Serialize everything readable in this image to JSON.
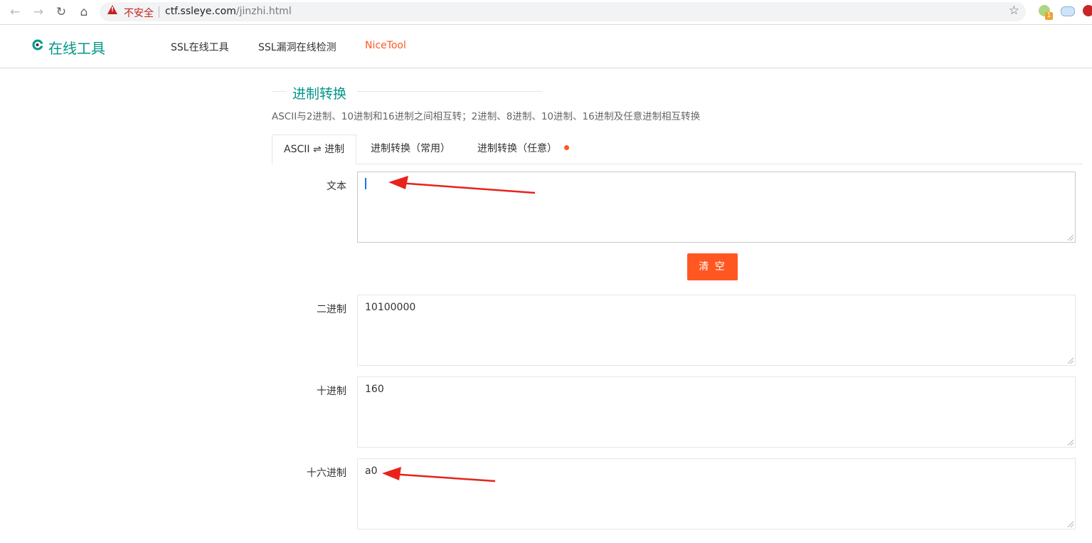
{
  "browser": {
    "security_label": "不安全",
    "url_host": "ctf.ssleye.com",
    "url_path": "/jinzhi.html",
    "extension_badge": "1"
  },
  "site": {
    "logo_text": "在线工具",
    "nav": [
      "SSL在线工具",
      "SSL漏洞在线检测",
      "NiceTool"
    ]
  },
  "main": {
    "title": "进制转换",
    "description": "ASCII与2进制、10进制和16进制之间相互转；2进制、8进制、10进制、16进制及任意进制相互转换",
    "tabs": [
      "ASCII ⇌ 进制",
      "进制转换（常用）",
      "进制转换（任意）"
    ],
    "fields": {
      "text_label": "文本",
      "text_value": "",
      "binary_label": "二进制",
      "binary_value": "10100000",
      "decimal_label": "十进制",
      "decimal_value": "160",
      "hex_label": "十六进制",
      "hex_value": "a0"
    },
    "clear_button": "清 空"
  },
  "colors": {
    "brand": "#009688",
    "accent": "#ff5722",
    "annotation_arrow": "#e8231c"
  }
}
